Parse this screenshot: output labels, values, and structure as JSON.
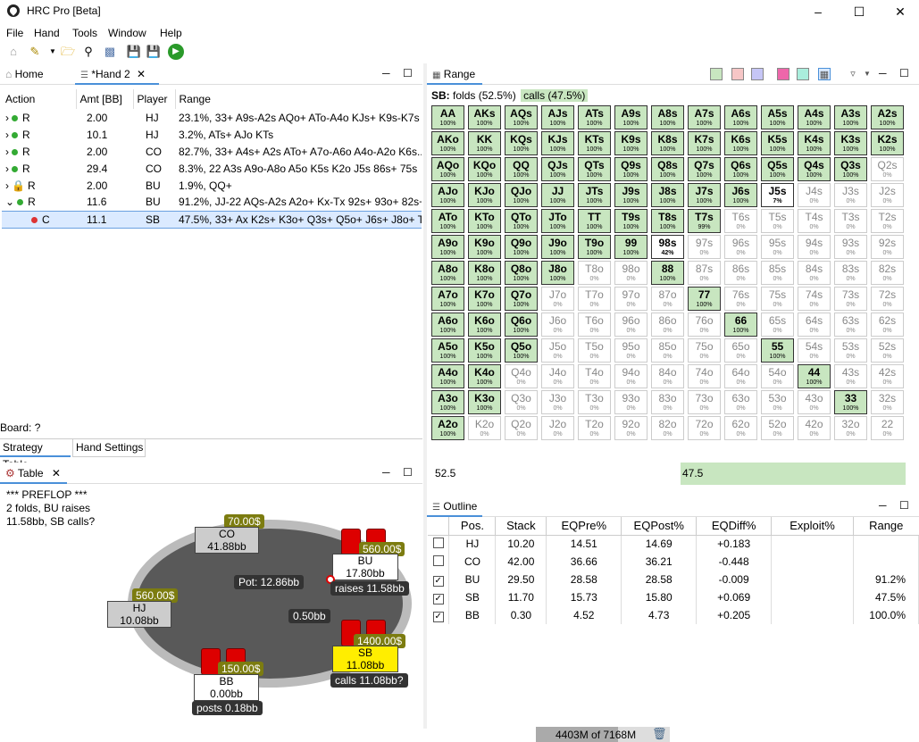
{
  "app": {
    "title": "HRC Pro [Beta]"
  },
  "menu": [
    "File",
    "Hand",
    "Tools",
    "Window",
    "Help"
  ],
  "left_tabs": {
    "home": "Home",
    "hand": "*Hand 2"
  },
  "hand_table": {
    "headers": [
      "Action",
      "Amt [BB]",
      "Player",
      "Range"
    ],
    "rows": [
      {
        "action": "R",
        "amt": "2.00",
        "player": "HJ",
        "range": "23.1%, 33+ A9s-A2s AQo+ ATo-A4o KJs+ K9s-K7s ..."
      },
      {
        "action": "R",
        "amt": "10.1",
        "player": "HJ",
        "range": "3.2%, ATs+ AJo KTs"
      },
      {
        "action": "R",
        "amt": "2.00",
        "player": "CO",
        "range": "82.7%, 33+ A4s+ A2s ATo+ A7o-A6o A4o-A2o K6s..."
      },
      {
        "action": "R",
        "amt": "29.4",
        "player": "CO",
        "range": "8.3%, 22 A3s A9o-A8o A5o K5s K2o J5s 86s+ 75s"
      },
      {
        "action": "R",
        "amt": "2.00",
        "player": "BU",
        "range": "1.9%, QQ+"
      },
      {
        "action": "R",
        "amt": "11.6",
        "player": "BU",
        "range": "91.2%, JJ-22 AQs-A2s A2o+ Kx-Tx 92s+ 93o+ 82s+..."
      },
      {
        "action": "C",
        "amt": "11.1",
        "player": "SB",
        "range": "47.5%, 33+ Ax K2s+ K3o+ Q3s+ Q5o+ J6s+ J8o+ T..."
      }
    ]
  },
  "board": "Board: ?",
  "bottom_tabs": [
    "Strategy Table",
    "Hand Settings"
  ],
  "table_pane": {
    "tab": "Table",
    "log": [
      "*** PREFLOP ***",
      "2 folds, BU raises",
      "11.58bb, SB calls?"
    ],
    "pot": "Pot:  12.86bb",
    "center_bet": "0.50bb",
    "seats": {
      "CO": {
        "name": "CO",
        "stack": "41.88bb",
        "chips": "70.00$"
      },
      "BU": {
        "name": "BU",
        "stack": "17.80bb",
        "chips": "560.00$",
        "note": "raises 11.58bb"
      },
      "HJ": {
        "name": "HJ",
        "stack": "10.08bb",
        "chips": "560.00$"
      },
      "SB": {
        "name": "SB",
        "stack": "11.08bb",
        "chips": "1400.00$",
        "note": "calls 11.08bb?"
      },
      "BB": {
        "name": "BB",
        "stack": "0.00bb",
        "chips": "150.00$",
        "note": "posts 0.18bb"
      }
    }
  },
  "range_pane": {
    "tab": "Range",
    "player": "SB:",
    "folds": "folds (52.5%)",
    "calls": "calls (47.5%)",
    "grid": [
      [
        [
          "AA",
          "100%",
          1
        ],
        [
          "AKs",
          "100%",
          1
        ],
        [
          "AQs",
          "100%",
          1
        ],
        [
          "AJs",
          "100%",
          1
        ],
        [
          "ATs",
          "100%",
          1
        ],
        [
          "A9s",
          "100%",
          1
        ],
        [
          "A8s",
          "100%",
          1
        ],
        [
          "A7s",
          "100%",
          1
        ],
        [
          "A6s",
          "100%",
          1
        ],
        [
          "A5s",
          "100%",
          1
        ],
        [
          "A4s",
          "100%",
          1
        ],
        [
          "A3s",
          "100%",
          1
        ],
        [
          "A2s",
          "100%",
          1
        ]
      ],
      [
        [
          "AKo",
          "100%",
          1
        ],
        [
          "KK",
          "100%",
          1
        ],
        [
          "KQs",
          "100%",
          1
        ],
        [
          "KJs",
          "100%",
          1
        ],
        [
          "KTs",
          "100%",
          1
        ],
        [
          "K9s",
          "100%",
          1
        ],
        [
          "K8s",
          "100%",
          1
        ],
        [
          "K7s",
          "100%",
          1
        ],
        [
          "K6s",
          "100%",
          1
        ],
        [
          "K5s",
          "100%",
          1
        ],
        [
          "K4s",
          "100%",
          1
        ],
        [
          "K3s",
          "100%",
          1
        ],
        [
          "K2s",
          "100%",
          1
        ]
      ],
      [
        [
          "AQo",
          "100%",
          1
        ],
        [
          "KQo",
          "100%",
          1
        ],
        [
          "QQ",
          "100%",
          1
        ],
        [
          "QJs",
          "100%",
          1
        ],
        [
          "QTs",
          "100%",
          1
        ],
        [
          "Q9s",
          "100%",
          1
        ],
        [
          "Q8s",
          "100%",
          1
        ],
        [
          "Q7s",
          "100%",
          1
        ],
        [
          "Q6s",
          "100%",
          1
        ],
        [
          "Q5s",
          "100%",
          1
        ],
        [
          "Q4s",
          "100%",
          1
        ],
        [
          "Q3s",
          "100%",
          1
        ],
        [
          "Q2s",
          "0%",
          0
        ]
      ],
      [
        [
          "AJo",
          "100%",
          1
        ],
        [
          "KJo",
          "100%",
          1
        ],
        [
          "QJo",
          "100%",
          1
        ],
        [
          "JJ",
          "100%",
          1
        ],
        [
          "JTs",
          "100%",
          1
        ],
        [
          "J9s",
          "100%",
          1
        ],
        [
          "J8s",
          "100%",
          1
        ],
        [
          "J7s",
          "100%",
          1
        ],
        [
          "J6s",
          "100%",
          1
        ],
        [
          "J5s",
          "7%",
          2
        ],
        [
          "J4s",
          "0%",
          0
        ],
        [
          "J3s",
          "0%",
          0
        ],
        [
          "J2s",
          "0%",
          0
        ]
      ],
      [
        [
          "ATo",
          "100%",
          1
        ],
        [
          "KTo",
          "100%",
          1
        ],
        [
          "QTo",
          "100%",
          1
        ],
        [
          "JTo",
          "100%",
          1
        ],
        [
          "TT",
          "100%",
          1
        ],
        [
          "T9s",
          "100%",
          1
        ],
        [
          "T8s",
          "100%",
          1
        ],
        [
          "T7s",
          "99%",
          1
        ],
        [
          "T6s",
          "0%",
          0
        ],
        [
          "T5s",
          "0%",
          0
        ],
        [
          "T4s",
          "0%",
          0
        ],
        [
          "T3s",
          "0%",
          0
        ],
        [
          "T2s",
          "0%",
          0
        ]
      ],
      [
        [
          "A9o",
          "100%",
          1
        ],
        [
          "K9o",
          "100%",
          1
        ],
        [
          "Q9o",
          "100%",
          1
        ],
        [
          "J9o",
          "100%",
          1
        ],
        [
          "T9o",
          "100%",
          1
        ],
        [
          "99",
          "100%",
          1
        ],
        [
          "98s",
          "42%",
          2
        ],
        [
          "97s",
          "0%",
          0
        ],
        [
          "96s",
          "0%",
          0
        ],
        [
          "95s",
          "0%",
          0
        ],
        [
          "94s",
          "0%",
          0
        ],
        [
          "93s",
          "0%",
          0
        ],
        [
          "92s",
          "0%",
          0
        ]
      ],
      [
        [
          "A8o",
          "100%",
          1
        ],
        [
          "K8o",
          "100%",
          1
        ],
        [
          "Q8o",
          "100%",
          1
        ],
        [
          "J8o",
          "100%",
          1
        ],
        [
          "T8o",
          "0%",
          0
        ],
        [
          "98o",
          "0%",
          0
        ],
        [
          "88",
          "100%",
          1
        ],
        [
          "87s",
          "0%",
          0
        ],
        [
          "86s",
          "0%",
          0
        ],
        [
          "85s",
          "0%",
          0
        ],
        [
          "84s",
          "0%",
          0
        ],
        [
          "83s",
          "0%",
          0
        ],
        [
          "82s",
          "0%",
          0
        ]
      ],
      [
        [
          "A7o",
          "100%",
          1
        ],
        [
          "K7o",
          "100%",
          1
        ],
        [
          "Q7o",
          "100%",
          1
        ],
        [
          "J7o",
          "0%",
          0
        ],
        [
          "T7o",
          "0%",
          0
        ],
        [
          "97o",
          "0%",
          0
        ],
        [
          "87o",
          "0%",
          0
        ],
        [
          "77",
          "100%",
          1
        ],
        [
          "76s",
          "0%",
          0
        ],
        [
          "75s",
          "0%",
          0
        ],
        [
          "74s",
          "0%",
          0
        ],
        [
          "73s",
          "0%",
          0
        ],
        [
          "72s",
          "0%",
          0
        ]
      ],
      [
        [
          "A6o",
          "100%",
          1
        ],
        [
          "K6o",
          "100%",
          1
        ],
        [
          "Q6o",
          "100%",
          1
        ],
        [
          "J6o",
          "0%",
          0
        ],
        [
          "T6o",
          "0%",
          0
        ],
        [
          "96o",
          "0%",
          0
        ],
        [
          "86o",
          "0%",
          0
        ],
        [
          "76o",
          "0%",
          0
        ],
        [
          "66",
          "100%",
          1
        ],
        [
          "65s",
          "0%",
          0
        ],
        [
          "64s",
          "0%",
          0
        ],
        [
          "63s",
          "0%",
          0
        ],
        [
          "62s",
          "0%",
          0
        ]
      ],
      [
        [
          "A5o",
          "100%",
          1
        ],
        [
          "K5o",
          "100%",
          1
        ],
        [
          "Q5o",
          "100%",
          1
        ],
        [
          "J5o",
          "0%",
          0
        ],
        [
          "T5o",
          "0%",
          0
        ],
        [
          "95o",
          "0%",
          0
        ],
        [
          "85o",
          "0%",
          0
        ],
        [
          "75o",
          "0%",
          0
        ],
        [
          "65o",
          "0%",
          0
        ],
        [
          "55",
          "100%",
          1
        ],
        [
          "54s",
          "0%",
          0
        ],
        [
          "53s",
          "0%",
          0
        ],
        [
          "52s",
          "0%",
          0
        ]
      ],
      [
        [
          "A4o",
          "100%",
          1
        ],
        [
          "K4o",
          "100%",
          1
        ],
        [
          "Q4o",
          "0%",
          0
        ],
        [
          "J4o",
          "0%",
          0
        ],
        [
          "T4o",
          "0%",
          0
        ],
        [
          "94o",
          "0%",
          0
        ],
        [
          "84o",
          "0%",
          0
        ],
        [
          "74o",
          "0%",
          0
        ],
        [
          "64o",
          "0%",
          0
        ],
        [
          "54o",
          "0%",
          0
        ],
        [
          "44",
          "100%",
          1
        ],
        [
          "43s",
          "0%",
          0
        ],
        [
          "42s",
          "0%",
          0
        ]
      ],
      [
        [
          "A3o",
          "100%",
          1
        ],
        [
          "K3o",
          "100%",
          1
        ],
        [
          "Q3o",
          "0%",
          0
        ],
        [
          "J3o",
          "0%",
          0
        ],
        [
          "T3o",
          "0%",
          0
        ],
        [
          "93o",
          "0%",
          0
        ],
        [
          "83o",
          "0%",
          0
        ],
        [
          "73o",
          "0%",
          0
        ],
        [
          "63o",
          "0%",
          0
        ],
        [
          "53o",
          "0%",
          0
        ],
        [
          "43o",
          "0%",
          0
        ],
        [
          "33",
          "100%",
          1
        ],
        [
          "32s",
          "0%",
          0
        ]
      ],
      [
        [
          "A2o",
          "100%",
          1
        ],
        [
          "K2o",
          "0%",
          0
        ],
        [
          "Q2o",
          "0%",
          0
        ],
        [
          "J2o",
          "0%",
          0
        ],
        [
          "T2o",
          "0%",
          0
        ],
        [
          "92o",
          "0%",
          0
        ],
        [
          "82o",
          "0%",
          0
        ],
        [
          "72o",
          "0%",
          0
        ],
        [
          "62o",
          "0%",
          0
        ],
        [
          "52o",
          "0%",
          0
        ],
        [
          "42o",
          "0%",
          0
        ],
        [
          "32o",
          "0%",
          0
        ],
        [
          "22",
          "0%",
          0
        ]
      ]
    ],
    "freq_fold": "52.5",
    "freq_call": "47.5",
    "freq_call_fraction": 0.475
  },
  "outline": {
    "tab": "Outline",
    "headers": [
      "Pos.",
      "Stack",
      "EQPre%",
      "EQPost%",
      "EQDiff%",
      "Exploit%",
      "Range"
    ],
    "rows": [
      {
        "checked": false,
        "pos": "HJ",
        "stack": "10.20",
        "pre": "14.51",
        "post": "14.69",
        "diff": "+0.183",
        "exploit": "",
        "range": ""
      },
      {
        "checked": false,
        "pos": "CO",
        "stack": "42.00",
        "pre": "36.66",
        "post": "36.21",
        "diff": "-0.448",
        "exploit": "",
        "range": ""
      },
      {
        "checked": true,
        "pos": "BU",
        "stack": "29.50",
        "pre": "28.58",
        "post": "28.58",
        "diff": "-0.009",
        "exploit": "",
        "range": "91.2%"
      },
      {
        "checked": true,
        "pos": "SB",
        "stack": "11.70",
        "pre": "15.73",
        "post": "15.80",
        "diff": "+0.069",
        "exploit": "",
        "range": "47.5%"
      },
      {
        "checked": true,
        "pos": "BB",
        "stack": "0.30",
        "pre": "4.52",
        "post": "4.73",
        "diff": "+0.205",
        "exploit": "",
        "range": "100.0%"
      }
    ]
  },
  "status": {
    "memory": "4403M of 7168M",
    "memory_fraction": 0.614
  },
  "colors": {
    "range_green": "#c8e6c0",
    "accent": "#4a90d9"
  }
}
